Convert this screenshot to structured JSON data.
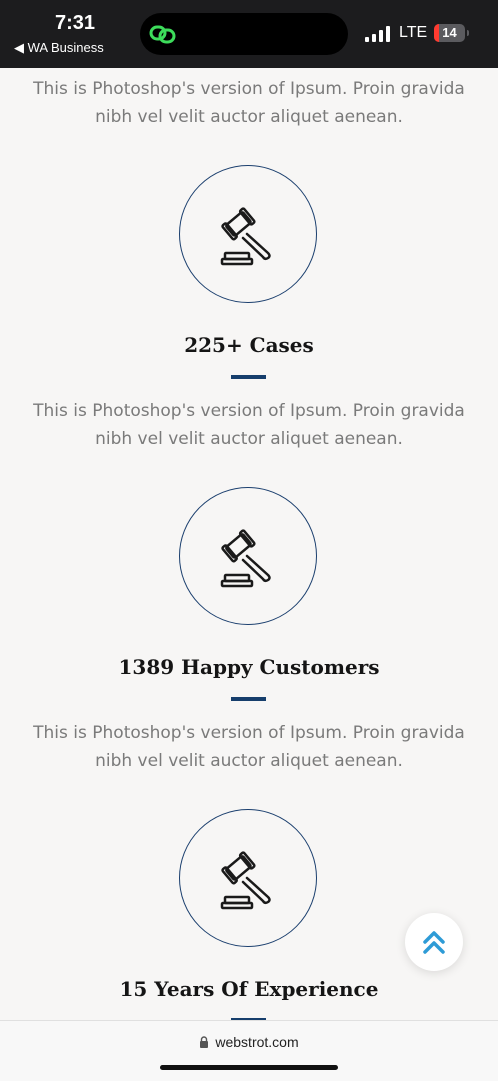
{
  "status_bar": {
    "time": "7:31",
    "back_app": "◀ WA Business",
    "network": "LTE",
    "battery": "14"
  },
  "stats": [
    {
      "description": "This is Photoshop's version of Ipsum. Proin gravida nibh vel velit auctor aliquet aenean.",
      "icon": "gavel-icon",
      "title": "225+ Cases"
    },
    {
      "description": "This is Photoshop's version of Ipsum. Proin gravida nibh vel velit auctor aliquet aenean.",
      "icon": "gavel-icon",
      "title": "1389 Happy Customers"
    },
    {
      "description": "This is Photoshop's version of Ipsum. Proin gravida nibh vel velit auctor aliquet aenean.",
      "icon": "gavel-icon",
      "title": "15 Years Of Experience"
    }
  ],
  "url_bar": {
    "domain": "webstrot.com"
  },
  "colors": {
    "accent": "#163e6c",
    "text_muted": "#7a7a7a",
    "title": "#151515"
  }
}
